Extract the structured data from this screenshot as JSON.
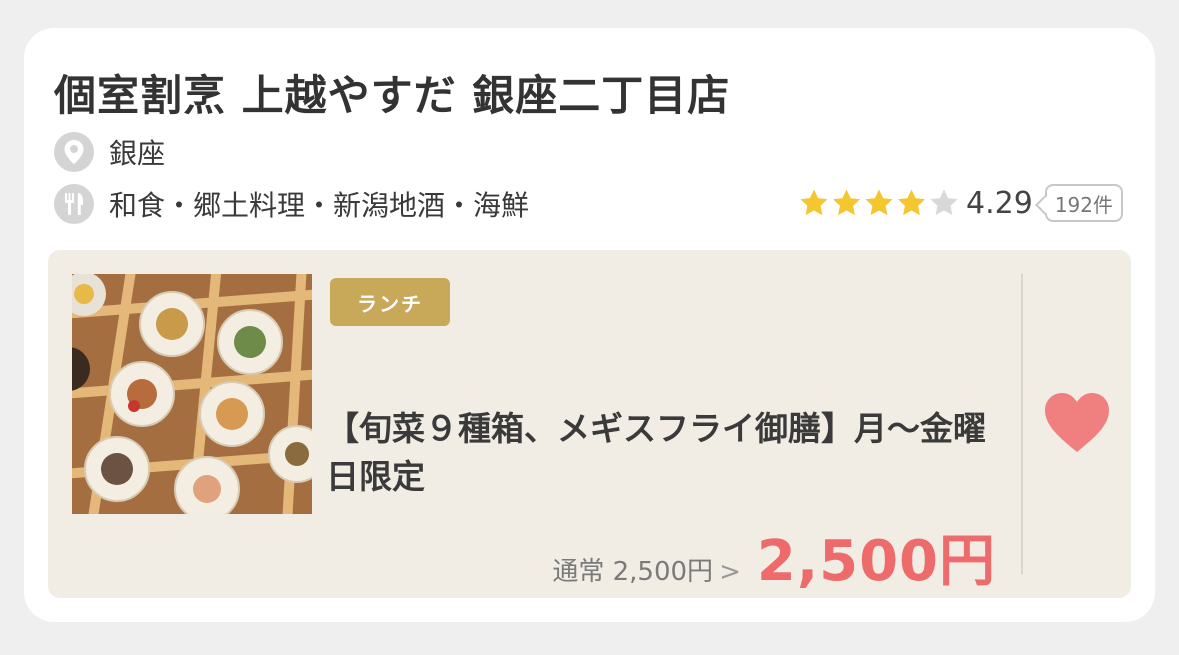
{
  "restaurant": {
    "name": "個室割烹 上越やすだ 銀座二丁目店",
    "area": "銀座",
    "genre": "和食・郷土料理・新潟地酒・海鮮",
    "rating": "4.29",
    "rating_value": 4.29,
    "review_count": "192件"
  },
  "plan": {
    "badge": "ランチ",
    "title": "【旬菜９種箱、メギスフライ御膳】月〜金曜日限定",
    "regular_price": "通常 2,500円",
    "price": "2,500円"
  },
  "colors": {
    "star": "#f4c62f",
    "star_empty": "#d8d8d8",
    "badge": "#c8a95a",
    "price": "#ee6b6b",
    "heart": "#f07f7f",
    "plan_bg": "#f1ede4"
  },
  "icons": {
    "area": "location-pin-icon",
    "genre": "fork-knife-icon",
    "favorite": "heart-icon"
  }
}
